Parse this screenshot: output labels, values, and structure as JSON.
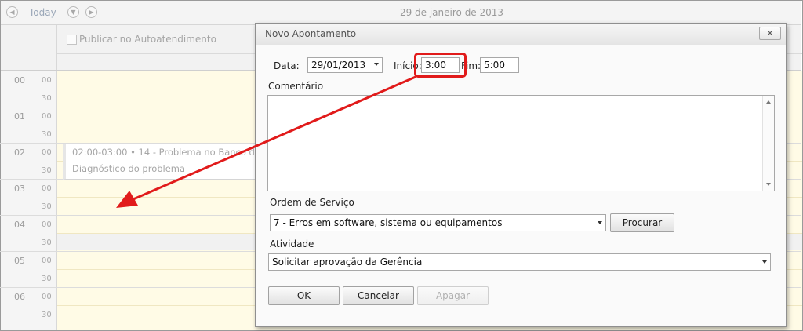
{
  "scheduler": {
    "today_label": "Today",
    "date_title": "29 de janeiro de 2013",
    "publish_label": "Publicar no Autoatendimento",
    "hours": [
      "00",
      "01",
      "02",
      "03",
      "04",
      "05",
      "06"
    ],
    "minutes_top": "00",
    "minutes_half": "30",
    "event": {
      "title": "02:00-03:00 • 14 - Problema no Banco d",
      "description": "Diagnóstico do problema"
    }
  },
  "dialog": {
    "title": "Novo Apontamento",
    "close_glyph": "✕",
    "data_label": "Data:",
    "data_value": "29/01/2013",
    "inicio_label": "Início:",
    "inicio_value": "3:00",
    "fim_label": "Fim:",
    "fim_value": "5:00",
    "comentario_label": "Comentário",
    "comentario_value": "",
    "ordem_label": "Ordem de Serviço",
    "ordem_value": "7 - Erros em software, sistema ou equipamentos",
    "procurar_label": "Procurar",
    "atividade_label": "Atividade",
    "atividade_value": "Solicitar aprovação da Gerência",
    "ok_label": "OK",
    "cancelar_label": "Cancelar",
    "apagar_label": "Apagar"
  },
  "annotation": {
    "color": "#e11b1b"
  }
}
